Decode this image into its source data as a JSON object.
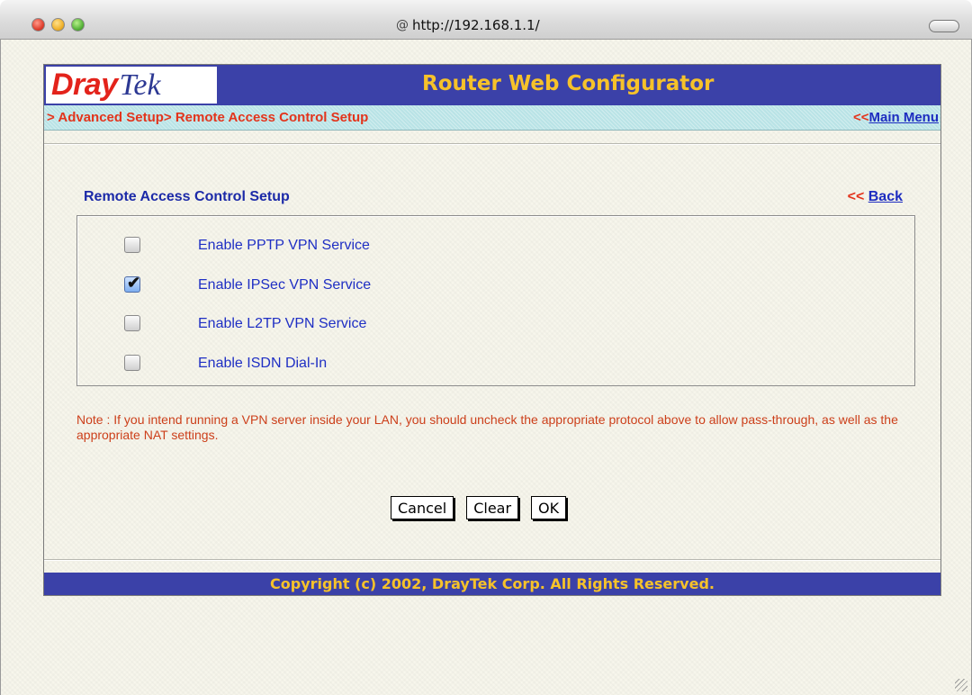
{
  "browser": {
    "url": "http://192.168.1.1/"
  },
  "header": {
    "logo_part1": "Dray",
    "logo_part2": "Tek",
    "title": "Router Web Configurator"
  },
  "breadcrumb": {
    "path": "> Advanced Setup> Remote Access Control Setup",
    "main_menu_prefix": "<<",
    "main_menu_label": "Main Menu"
  },
  "section": {
    "title": "Remote Access Control Setup",
    "back_prefix": "<< ",
    "back_label": "Back"
  },
  "options": [
    {
      "label": "Enable PPTP VPN Service",
      "checked": false
    },
    {
      "label": "Enable IPSec VPN Service",
      "checked": true
    },
    {
      "label": "Enable L2TP VPN Service",
      "checked": false
    },
    {
      "label": "Enable ISDN Dial-In",
      "checked": false
    }
  ],
  "note": "Note : If you intend running a VPN server inside your LAN, you should uncheck the appropriate protocol above to allow pass-through, as well as the appropriate NAT settings.",
  "buttons": {
    "cancel": "Cancel",
    "clear": "Clear",
    "ok": "OK"
  },
  "footer": {
    "copyright": "Copyright (c) 2002, DrayTek Corp. All Rights Reserved."
  },
  "colors": {
    "header_bg": "#3b41a8",
    "header_text": "#f6c22a",
    "accent_red": "#e3341c",
    "link_blue": "#1d2cc0"
  },
  "icons": {
    "checkbox_checked": "checkmark-icon"
  }
}
